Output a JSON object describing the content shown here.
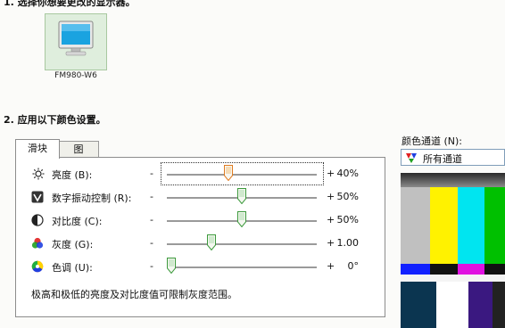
{
  "section1": {
    "title": "1. 选择你想要更改的显示器。"
  },
  "monitor": {
    "name": "FM980-W6",
    "icon": "monitor-icon"
  },
  "section2": {
    "title": "2. 应用以下颜色设置。"
  },
  "tabs": [
    {
      "label": "滑块"
    },
    {
      "label": "图"
    }
  ],
  "sliders": [
    {
      "label": "亮度 (B):",
      "value": "40%",
      "level": 0.4,
      "icon": "brightness-icon"
    },
    {
      "label": "数字振动控制 (R):",
      "value": "50%",
      "level": 0.5,
      "icon": "digital-vibrance-icon"
    },
    {
      "label": "对比度 (C):",
      "value": "50%",
      "level": 0.5,
      "icon": "contrast-icon"
    },
    {
      "label": "灰度 (G):",
      "value": "1.00",
      "level": 0.25,
      "icon": "gamma-icon"
    },
    {
      "label": "色调 (U):",
      "value": "0°",
      "level": 0.0,
      "icon": "hue-icon"
    }
  ],
  "minus_sign": "-",
  "plus_sign": "+",
  "note": "极高和极低的亮度及对比度值可限制灰度范围。",
  "channel": {
    "label": "颜色通道 (N):",
    "selected": "所有通道",
    "icon": "rgb-channels-icon"
  },
  "colors": {
    "tile_bg": "#dfeedd",
    "bar_yellow": "#fff200",
    "bar_cyan": "#00e5f0",
    "bar_green": "#00c000",
    "bar_grey": "#c0c0c0"
  }
}
